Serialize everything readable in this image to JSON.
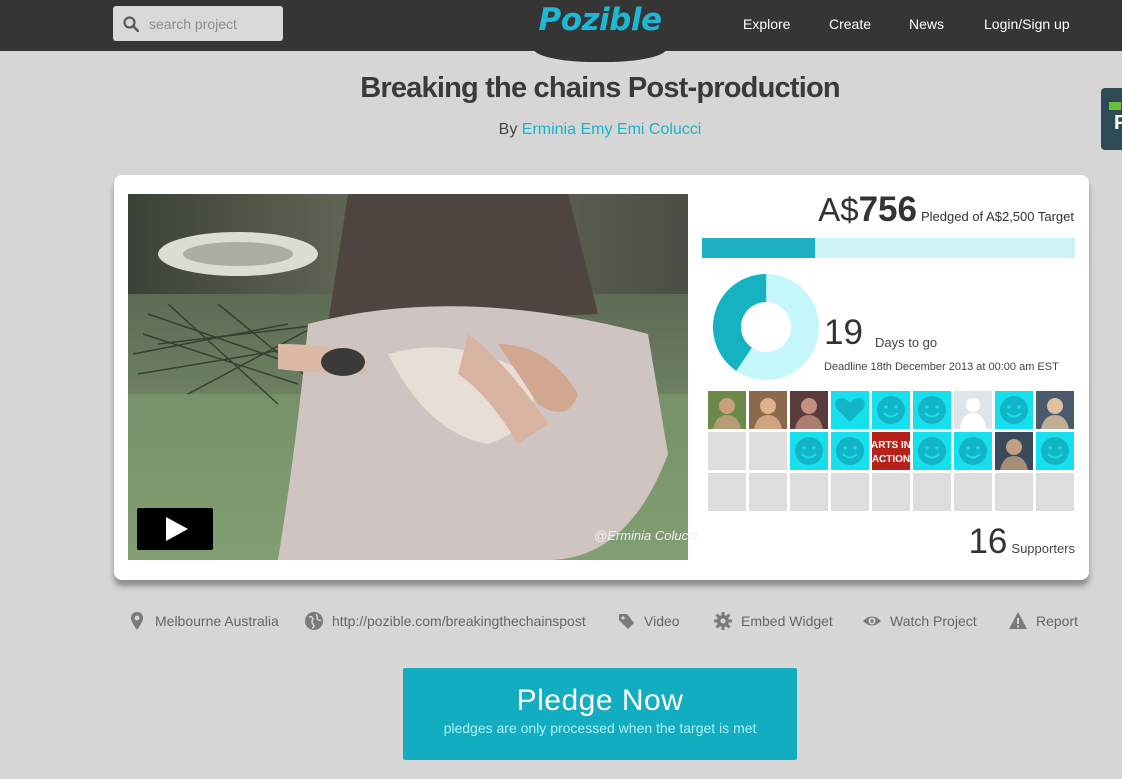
{
  "header": {
    "search_placeholder": "search project",
    "logo": "Pozible",
    "nav": [
      "Explore",
      "Create",
      "News",
      "Login/Sign up"
    ]
  },
  "project": {
    "title": "Breaking the chains Post-production",
    "by_label": "By",
    "author": "Erminia Emy Emi Colucci",
    "video_watermark": "@Erminia Colucci"
  },
  "funding": {
    "currency": "A$",
    "pledged": "756",
    "target_label": "Pledged of A$2,500 Target",
    "progress_fraction": 0.302,
    "days": "19",
    "days_label": "Days to go",
    "deadline": "Deadline 18th December 2013 at 00:00 am EST",
    "supporters": "16",
    "supporters_label": "Supporters"
  },
  "supporter_tiles": [
    "photo",
    "photo",
    "photo",
    "heart",
    "smile",
    "smile",
    "silhouette",
    "smile",
    "photo",
    "empty",
    "empty",
    "smile",
    "smile",
    "arts",
    "smile",
    "smile",
    "photo",
    "smile",
    "empty",
    "empty",
    "empty",
    "empty",
    "empty",
    "empty",
    "empty",
    "empty",
    "empty"
  ],
  "arts_tile_text": [
    "ARTS IN",
    "ACTION"
  ],
  "toolbar": {
    "location": "Melbourne Australia",
    "url": "http://pozible.com/breakingthechainspost",
    "video": "Video",
    "embed": "Embed Widget",
    "watch": "Watch Project",
    "report": "Report"
  },
  "pledge": {
    "label": "Pledge Now",
    "note": "pledges are only processed when the target is met"
  },
  "colors": {
    "accent": "#1eb0c4",
    "progress_bg": "#cdf5f8",
    "smile_tile": "#16e0ee",
    "pledge_button": "#12adc0",
    "topbar": "#353535"
  }
}
